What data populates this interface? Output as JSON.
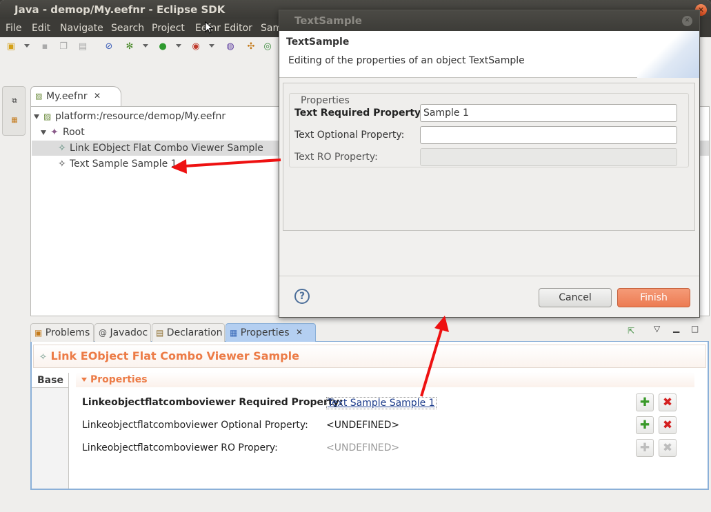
{
  "window": {
    "title": "Java - demop/My.eefnr - Eclipse SDK"
  },
  "menu": [
    "File",
    "Edit",
    "Navigate",
    "Search",
    "Project",
    "Eefnr Editor",
    "Sam"
  ],
  "editor": {
    "tab_label": "My.eefnr",
    "tree": {
      "resource": "platform:/resource/demop/My.eefnr",
      "root": "Root",
      "child1": "Link EObject Flat Combo Viewer Sample",
      "child2": "Text Sample Sample 1"
    }
  },
  "bottom_tabs": {
    "problems": "Problems",
    "javadoc": "Javadoc",
    "declaration": "Declaration",
    "properties": "Properties"
  },
  "properties_view": {
    "header": "Link EObject Flat Combo Viewer Sample",
    "base_tab": "Base",
    "section": "Properties",
    "rows": [
      {
        "label": "Linkeobjectflatcomboviewer Required Property:",
        "value": "Text Sample Sample 1"
      },
      {
        "label": "Linkeobjectflatcomboviewer Optional Property:",
        "value": "<UNDEFINED>"
      },
      {
        "label": "Linkeobjectflatcomboviewer RO Propery:",
        "value": "<UNDEFINED>"
      }
    ]
  },
  "dialog": {
    "title": "TextSample",
    "heading": "TextSample",
    "description": "Editing of the properties of an object TextSample",
    "group": "Properties",
    "fields": [
      {
        "label": "Text Required Property:",
        "value": "Sample 1"
      },
      {
        "label": "Text Optional Property:",
        "value": ""
      },
      {
        "label": "Text RO Property:",
        "value": ""
      }
    ],
    "cancel": "Cancel",
    "finish": "Finish",
    "help": "?"
  },
  "colors": {
    "accent_orange": "#ec7b46",
    "selection_blue": "#8bb0d8",
    "annotation_arrow": "#ee1111"
  }
}
